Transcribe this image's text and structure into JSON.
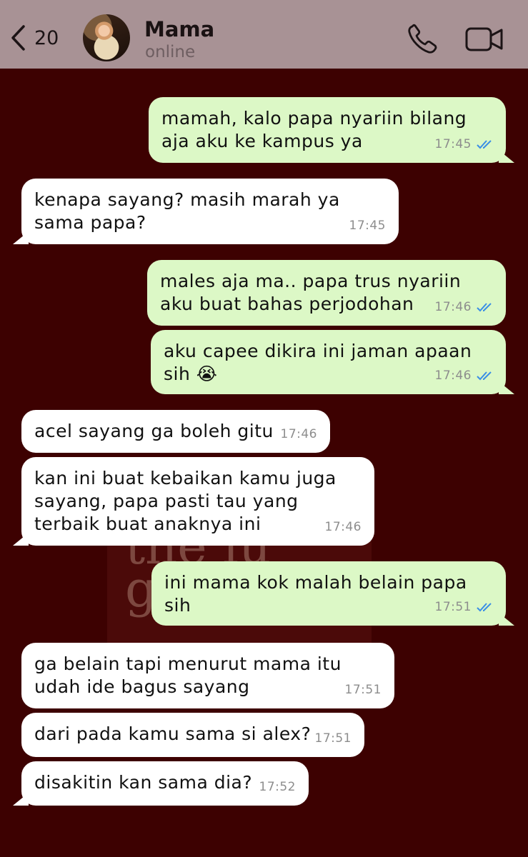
{
  "header": {
    "back_count": "20",
    "contact_name": "Mama",
    "contact_status": "online"
  },
  "background": {
    "cover_text": "the lu girl"
  },
  "messages": [
    {
      "dir": "out",
      "text": "mamah, kalo papa nyariin bilang aja aku ke kampus ya",
      "time": "17:45",
      "read": true
    },
    {
      "dir": "in",
      "text": "kenapa sayang? masih marah ya sama papa?",
      "time": "17:45"
    },
    {
      "dir": "out",
      "text": "males aja ma.. papa trus nyariin aku buat bahas perjodohan",
      "time": "17:46",
      "read": true
    },
    {
      "dir": "out",
      "text": "aku capee dikira ini jaman apaan sih 😭",
      "time": "17:46",
      "read": true
    },
    {
      "dir": "in",
      "text": "acel sayang ga boleh gitu",
      "time": "17:46"
    },
    {
      "dir": "in",
      "text": "kan ini buat kebaikan kamu juga sayang, papa pasti tau yang terbaik buat anaknya ini",
      "time": "17:46"
    },
    {
      "dir": "out",
      "text": "ini mama kok malah belain papa sih",
      "time": "17:51",
      "read": true
    },
    {
      "dir": "in",
      "text": "ga belain tapi menurut mama itu udah ide bagus sayang",
      "time": "17:51"
    },
    {
      "dir": "in",
      "text": "dari pada kamu sama si alex?",
      "time": "17:51"
    },
    {
      "dir": "in",
      "text": "disakitin kan sama dia?",
      "time": "17:52"
    }
  ],
  "colors": {
    "header_bg": "#a89295",
    "chat_bg": "#3d0101",
    "outgoing_bubble": "#dcf8c6",
    "incoming_bubble": "#ffffff",
    "read_ticks": "#3a8ee6"
  },
  "icons": [
    "chevron-left-icon",
    "phone-icon",
    "video-camera-icon",
    "double-check-icon"
  ]
}
